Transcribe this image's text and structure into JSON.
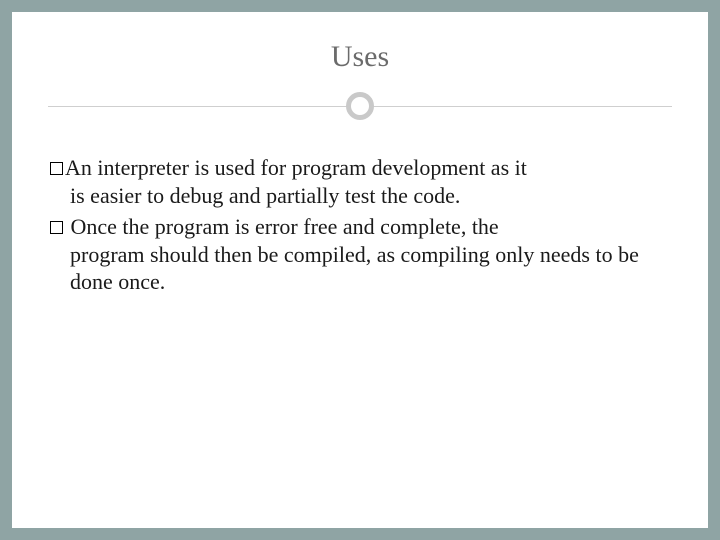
{
  "slide": {
    "title": "Uses",
    "bullets": [
      {
        "line1": "An interpreter is used for program development as it",
        "rest": "is easier to debug and partially test the code."
      },
      {
        "line1": " Once the program is error free and complete, the",
        "rest": "program should then be compiled, as compiling only needs to be done once."
      }
    ]
  }
}
